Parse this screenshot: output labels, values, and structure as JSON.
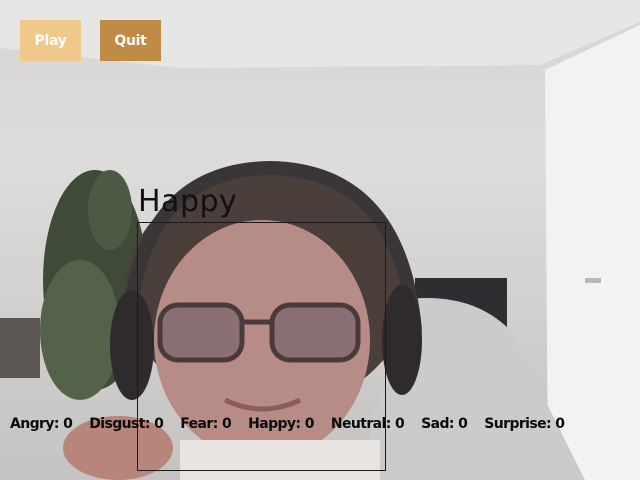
{
  "buttons": {
    "play_label": "Play",
    "quit_label": "Quit"
  },
  "detection": {
    "emotion": "Happy"
  },
  "emotion_counts": [
    "Angry: 0",
    "Disgust: 0",
    "Fear: 0",
    "Happy: 0",
    "Neutral: 0",
    "Sad: 0",
    "Surprise: 0"
  ],
  "colors": {
    "play_button": "#f0c88a",
    "quit_button": "#c08b45",
    "face_box": "#1a1a1a",
    "text": "#0a0a0a"
  }
}
